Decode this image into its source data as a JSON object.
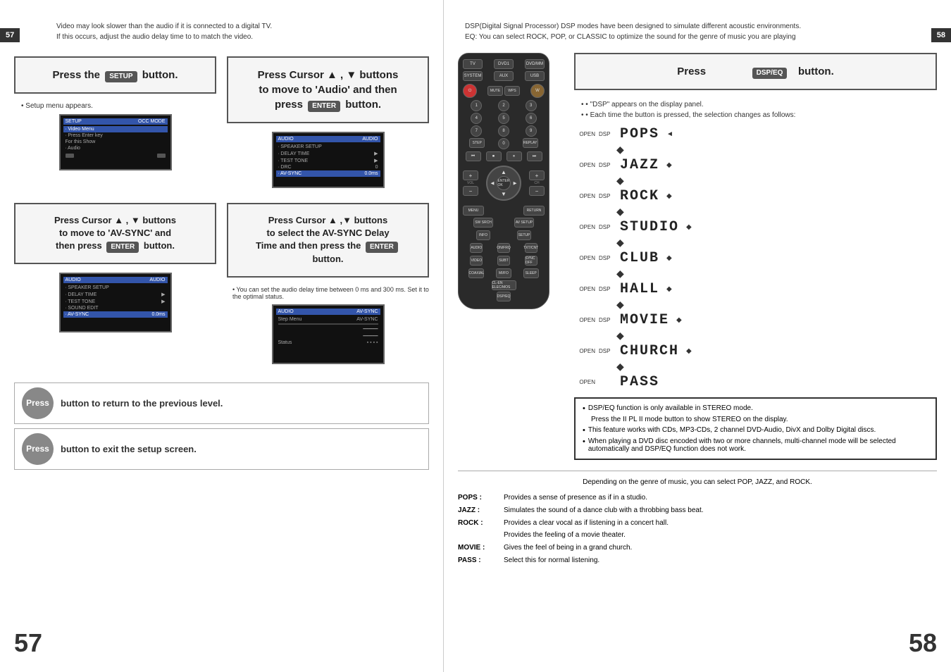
{
  "pages": {
    "left": {
      "number": "57",
      "info_note": "Video may look slower than the audio if it is connected to a digital TV.\nIf this occurs, adjust the audio delay time to to match the video.",
      "step1": {
        "instruction": "Press the",
        "button": "SETUP",
        "suffix": "button.",
        "bullet": "Setup menu appears."
      },
      "step2": {
        "instruction": "Press Cursor ▲ , ▼ buttons\nto move to 'Audio' and then\npress",
        "button": "ENTER",
        "suffix": "button."
      },
      "step3": {
        "instruction": "Press Cursor ▲ , ▼ buttons\nto move to 'AV-SYNC' and\nthen press",
        "button": "ENTER",
        "suffix": "button."
      },
      "step4": {
        "instruction": "Press Cursor ▲ ,▼ buttons\nto select the AV-SYNC Delay\nTime  and then press the",
        "button": "ENTER",
        "suffix": "button.",
        "bullet": "You can set the audio delay time between 0 ms\nand 300 ms. Set it to the optimal status."
      },
      "bottom": {
        "press1_label": "Press",
        "press1_text": "button to return to the previous level.",
        "press2_label": "Press",
        "press2_text": "button to exit the setup screen."
      }
    },
    "right": {
      "number": "58",
      "info_text": "DSP(Digital Signal Processor) DSP modes have been designed to simulate different acoustic environments.\nEQ: You can select ROCK, POP, or CLASSIC to optimize the sound for the genre of music you are playing",
      "instruction": {
        "press": "Press",
        "button": "DSP/EQ",
        "suffix": "button."
      },
      "bullets": [
        "\"DSP\" appears on the display panel.",
        "Each time the button is pressed, the selection changes as follows:"
      ],
      "dsp_modes": [
        {
          "label1": "OPEN",
          "label2": "DSP",
          "name": "POPS",
          "arrow": "◄"
        },
        {
          "label1": "OPEN",
          "label2": "DSP",
          "name": "JAZZ",
          "arrow": "◆"
        },
        {
          "label1": "OPEN",
          "label2": "DSP",
          "name": "ROCK",
          "arrow": "◆"
        },
        {
          "label1": "OPEN",
          "label2": "DSP",
          "name": "STUDIO",
          "arrow": "◆"
        },
        {
          "label1": "OPEN",
          "label2": "DSP",
          "name": "CLUB",
          "arrow": "◆"
        },
        {
          "label1": "OPEN",
          "label2": "DSP",
          "name": "HALL",
          "arrow": "◆"
        },
        {
          "label1": "OPEN",
          "label2": "DSP",
          "name": "MOVIE",
          "arrow": "◆"
        },
        {
          "label1": "OPEN",
          "label2": "DSP",
          "name": "CHURCH",
          "arrow": "◆"
        },
        {
          "label1": "OPEN",
          "label2": "",
          "name": "PASS",
          "arrow": ""
        }
      ],
      "notes": [
        "DSP/EQ function is only available in STEREO mode.",
        "Press the  II  PL II mode button to show STEREO on the display.",
        "This feature works with CDs, MP3-CDs, 2 channel DVD-Audio, DivX and Dolby Digital discs.",
        "When playing a DVD disc encoded with two or more channels, multi-channel mode will be selected automatically and DSP/EQ function does not work."
      ],
      "genre_intro": "Depending on the genre of music, you can select POP, JAZZ, and ROCK.",
      "genres": [
        {
          "label": "POPS :",
          "desc": "Provides a sense of presence as if in a studio."
        },
        {
          "label": "JAZZ :",
          "desc": "Simulates the sound of a dance club with a throbbing bass beat."
        },
        {
          "label": "ROCK :",
          "desc": "Provides a clear vocal as if listening in a concert hall.\nProvides the feeling of a movie theater."
        },
        {
          "label": "MOVIE :",
          "desc": "Gives the feel of being in a grand church."
        },
        {
          "label": "PASS :",
          "desc": "Select this for normal listening."
        }
      ]
    }
  },
  "icons": {
    "setup_button": "SETUP",
    "enter_button": "ENTER/OK",
    "return_button": "RETURN",
    "menu_button": "MENU",
    "dsp_button": "DSP/EQ"
  }
}
